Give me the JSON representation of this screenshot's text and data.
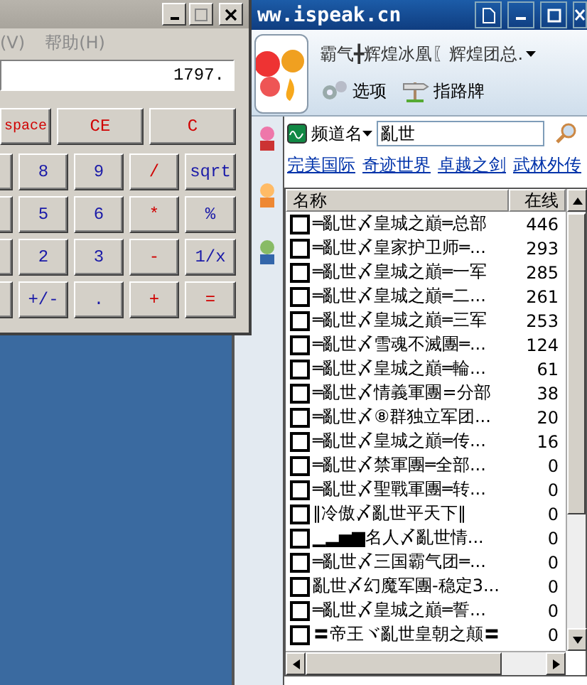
{
  "calculator": {
    "menu": [
      "(V)",
      "帮助(H)"
    ],
    "display": "1797.",
    "top_keys": [
      {
        "label": "space",
        "kind": "operator"
      },
      {
        "label": "CE",
        "kind": "operator"
      },
      {
        "label": "C",
        "kind": "operator"
      }
    ],
    "key_rows": [
      [
        {
          "label": "8",
          "kind": "digit"
        },
        {
          "label": "9",
          "kind": "digit"
        },
        {
          "label": "/",
          "kind": "operator"
        },
        {
          "label": "sqrt",
          "kind": "digit"
        }
      ],
      [
        {
          "label": "5",
          "kind": "digit"
        },
        {
          "label": "6",
          "kind": "digit"
        },
        {
          "label": "*",
          "kind": "operator"
        },
        {
          "label": "%",
          "kind": "digit"
        }
      ],
      [
        {
          "label": "2",
          "kind": "digit"
        },
        {
          "label": "3",
          "kind": "digit"
        },
        {
          "label": "-",
          "kind": "operator"
        },
        {
          "label": "1/x",
          "kind": "digit"
        }
      ],
      [
        {
          "label": "+/-",
          "kind": "digit"
        },
        {
          "label": ".",
          "kind": "digit"
        },
        {
          "label": "+",
          "kind": "operator"
        },
        {
          "label": "=",
          "kind": "operator"
        }
      ]
    ]
  },
  "ispeak": {
    "title": "ww.ispeak.cn",
    "user": "霸气╋辉煌冰凰〖辉煌团总.",
    "toolbar": [
      "选项",
      "指路牌"
    ],
    "search": {
      "scope": "频道名",
      "value": "亂世"
    },
    "links": [
      "完美国际",
      "奇迹世界",
      "卓越之剑",
      "武林外传"
    ],
    "columns": [
      "名称",
      "在线"
    ],
    "rows": [
      {
        "name": "═亂世〆皇城之巔═总部",
        "online": "446",
        "checked": false
      },
      {
        "name": "═亂世〆皇家护卫师═...",
        "online": "293",
        "checked": false
      },
      {
        "name": "═亂世〆皇城之巔═一军",
        "online": "285",
        "checked": false
      },
      {
        "name": "═亂世〆皇城之巔═二...",
        "online": "261",
        "checked": false
      },
      {
        "name": "═亂世〆皇城之巔═三军",
        "online": "253",
        "checked": false
      },
      {
        "name": "═亂世〆雪魂不滅團═...",
        "online": "124",
        "checked": false
      },
      {
        "name": "═亂世〆皇城之巔═輪...",
        "online": "61",
        "checked": false
      },
      {
        "name": "═亂世〆情義軍團=分部",
        "online": "38",
        "checked": false
      },
      {
        "name": "═亂世〆⑧群独立军团...",
        "online": "20",
        "checked": false
      },
      {
        "name": "═亂世〆皇城之巔═传...",
        "online": "16",
        "checked": false
      },
      {
        "name": "═亂世〆禁軍團═全部...",
        "online": "0",
        "checked": false
      },
      {
        "name": "═亂世〆聖戰軍團═转...",
        "online": "0",
        "checked": false
      },
      {
        "name": "‖冷傲〆亂世平天下‖",
        "online": "0",
        "checked": false
      },
      {
        "name": "▁▂▅▆名人〆亂世情...",
        "online": "0",
        "checked": false
      },
      {
        "name": "═亂世〆三国霸气团═...",
        "online": "0",
        "checked": false
      },
      {
        "name": "亂世〆幻魔军團-稳定3...",
        "online": "0",
        "checked": false
      },
      {
        "name": "═亂世〆皇城之巔═誓...",
        "online": "0",
        "checked": false
      },
      {
        "name": "〓帝王ヾ亂世皇朝之颠〓",
        "online": "0",
        "checked": false
      }
    ]
  }
}
